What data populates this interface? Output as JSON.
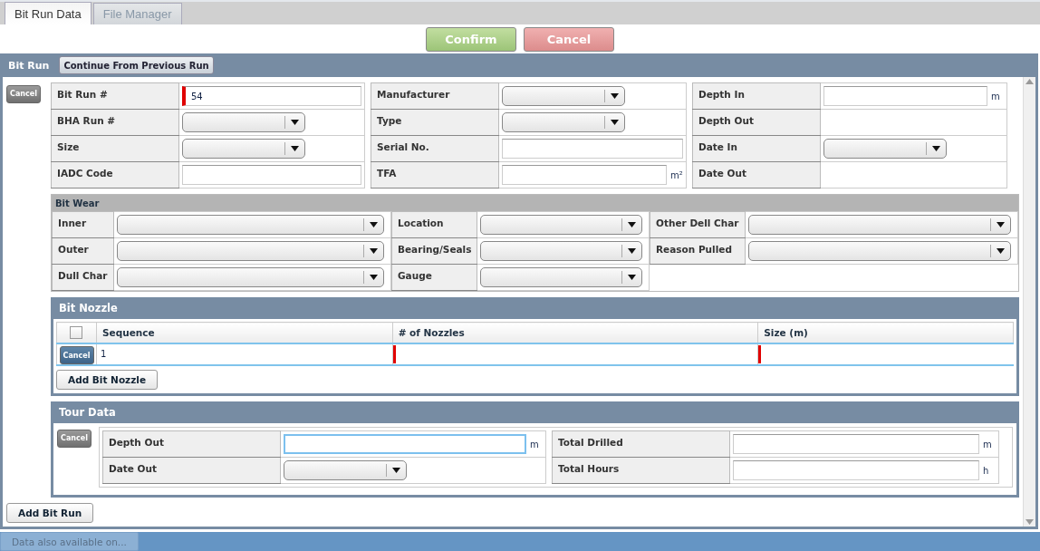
{
  "tabs": [
    {
      "label": "Bit Run Data",
      "selected": true
    },
    {
      "label": "File Manager",
      "selected": false
    }
  ],
  "actions": [
    {
      "label": "Confirm",
      "kind": "confirm"
    },
    {
      "label": "Cancel",
      "kind": "cancel"
    }
  ],
  "bit_run": {
    "title": "Bit Run",
    "continue_button": "Continue From Previous Run",
    "cancel_button": "Cancel",
    "field_groups": [
      [
        {
          "label": "Bit Run #",
          "kind": "text",
          "value": "54",
          "required": true,
          "focused": false
        },
        {
          "label": "BHA Run #",
          "kind": "select"
        },
        {
          "label": "Size",
          "kind": "select"
        },
        {
          "label": "IADC Code",
          "kind": "text",
          "required": false,
          "focused": false
        }
      ],
      [
        {
          "label": "Manufacturer",
          "kind": "select"
        },
        {
          "label": "Type",
          "kind": "select"
        },
        {
          "label": "Serial No.",
          "kind": "text",
          "required": false,
          "focused": false
        },
        {
          "label": "TFA",
          "kind": "text",
          "unit": "m²",
          "required": false,
          "focused": false
        }
      ],
      [
        {
          "label": "Depth In",
          "kind": "text",
          "unit": "m",
          "required": false,
          "focused": false
        },
        {
          "label": "Depth Out",
          "kind": "readonly"
        },
        {
          "label": "Date In",
          "kind": "select"
        },
        {
          "label": "Date Out",
          "kind": "readonly"
        }
      ]
    ],
    "bit_wear": {
      "title": "Bit Wear",
      "columns": [
        [
          {
            "label": "Inner",
            "kind": "select"
          },
          {
            "label": "Outer",
            "kind": "select"
          },
          {
            "label": "Dull Char",
            "kind": "select"
          }
        ],
        [
          {
            "label": "Location",
            "kind": "select"
          },
          {
            "label": "Bearing/Seals",
            "kind": "select"
          },
          {
            "label": "Gauge",
            "kind": "select"
          }
        ],
        [
          {
            "label": "Other Dell Char",
            "kind": "select"
          },
          {
            "label": "Reason Pulled",
            "kind": "select"
          }
        ]
      ]
    },
    "bit_nozzle": {
      "title": "Bit Nozzle",
      "select_all_checked": false,
      "columns": [
        "Sequence",
        "# of Nozzles",
        "Size (m)"
      ],
      "rows": [
        {
          "selected": true,
          "cancel_button": "Cancel",
          "cells": [
            {
              "value": "1",
              "required": false
            },
            {
              "required": true
            },
            {
              "required": true
            }
          ]
        }
      ],
      "add_button": "Add Bit Nozzle"
    },
    "tour_data": {
      "title": "Tour Data",
      "cancel_button": "Cancel",
      "field_groups": [
        [
          {
            "label": "Depth Out",
            "kind": "text",
            "unit": "m",
            "required": false,
            "focused": true
          },
          {
            "label": "Date Out",
            "kind": "select"
          }
        ],
        [
          {
            "label": "Total Drilled",
            "kind": "text",
            "unit": "m",
            "required": false,
            "focused": false
          },
          {
            "label": "Total Hours",
            "kind": "text",
            "unit": "h",
            "required": false,
            "focused": false
          }
        ]
      ]
    },
    "add_button": "Add Bit Run"
  },
  "status_bar": {
    "button": "Data also available on..."
  }
}
